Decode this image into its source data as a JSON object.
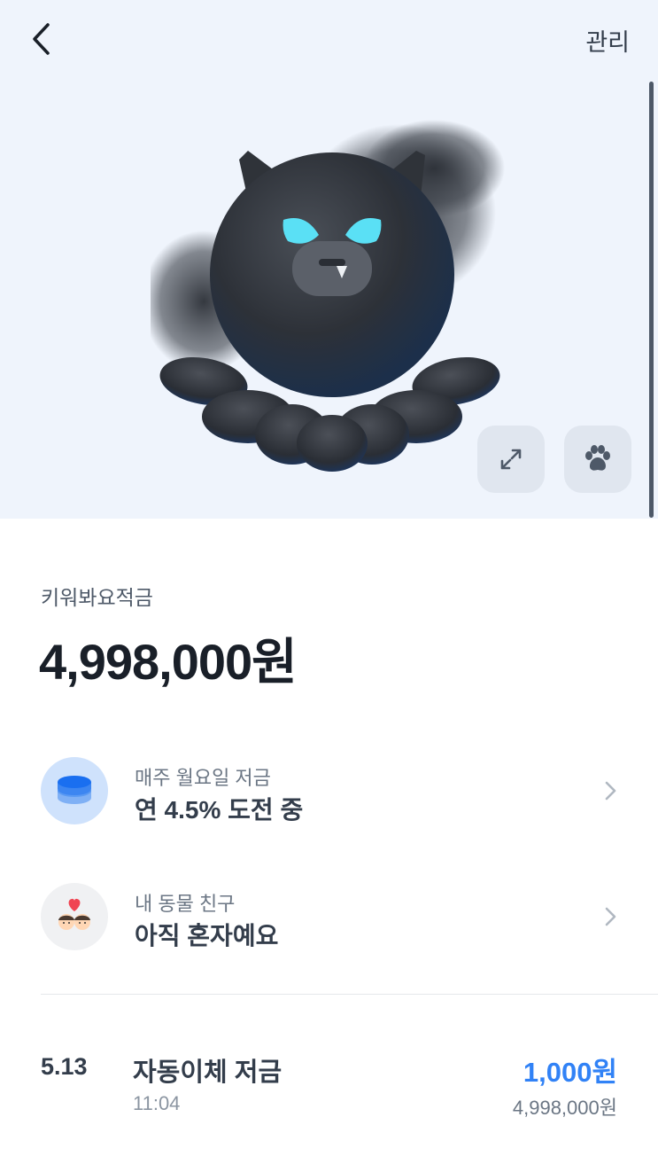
{
  "header": {
    "back_icon": "chevron-left-icon",
    "manage_label": "관리"
  },
  "hero": {
    "background": "#eff4fc",
    "character": "dark octopus character with blue eyes",
    "expand_icon": "expand-arrows-icon",
    "paw_icon": "paw-icon"
  },
  "account": {
    "product_name": "키워봐요적금",
    "balance": "4,998,000원"
  },
  "rows": [
    {
      "icon": "coin-stack-icon",
      "subtitle": "매주 월요일 저금",
      "title": "연 4.5% 도전 중"
    },
    {
      "icon": "friends-heart-icon",
      "subtitle": "내 동물 친구",
      "title": "아직 혼자예요"
    }
  ],
  "transactions": [
    {
      "date": "5.13",
      "title": "자동이체 저금",
      "time": "11:04",
      "amount": "1,000원",
      "balance_after": "4,998,000원"
    }
  ],
  "colors": {
    "accent": "#3182f6",
    "text_primary": "#191f28",
    "text_secondary": "#6b7684"
  }
}
